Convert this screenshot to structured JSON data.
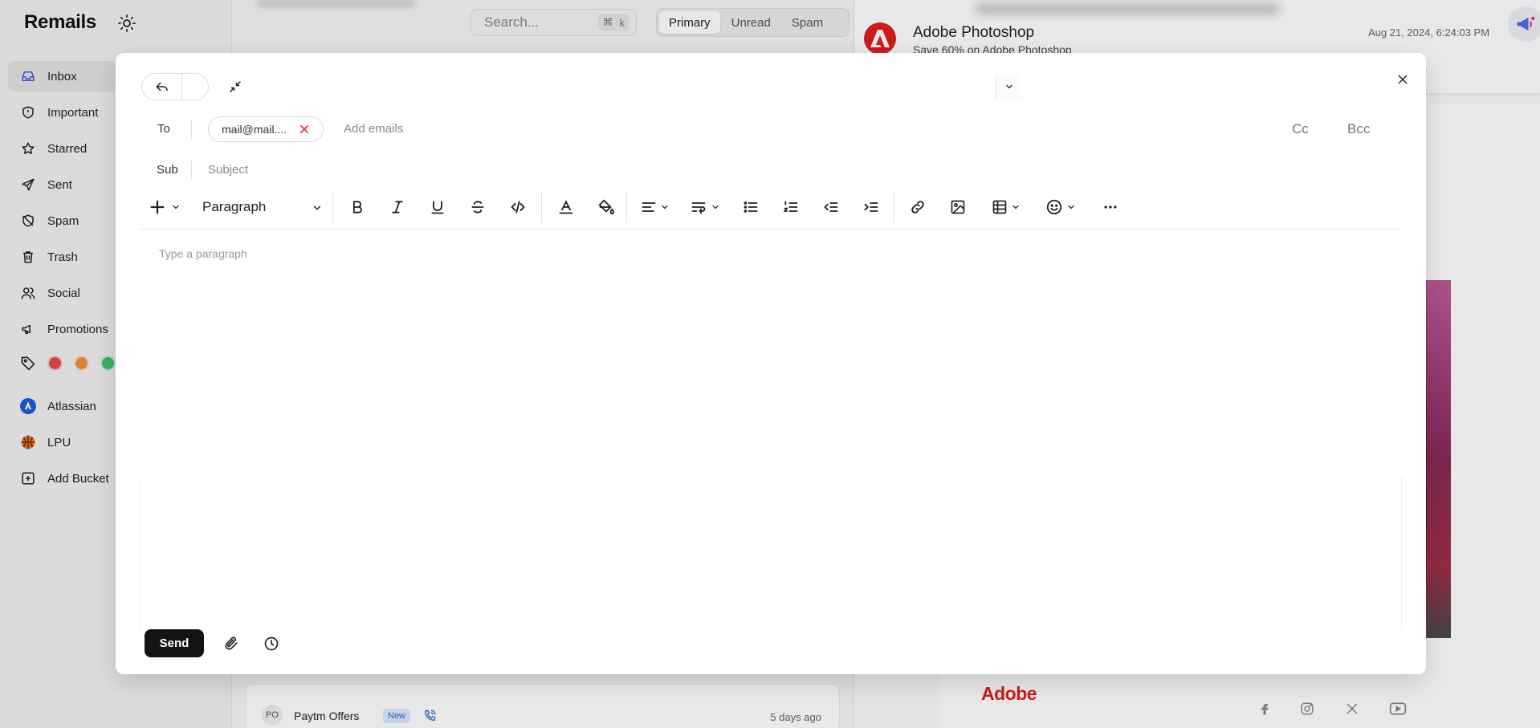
{
  "app": {
    "brand": "Remails"
  },
  "sidebar": {
    "items": [
      {
        "label": "Inbox",
        "icon": "inbox-icon"
      },
      {
        "label": "Important",
        "icon": "shield-icon"
      },
      {
        "label": "Starred",
        "icon": "star-icon"
      },
      {
        "label": "Sent",
        "icon": "send-icon"
      },
      {
        "label": "Spam",
        "icon": "shield-off-icon"
      },
      {
        "label": "Trash",
        "icon": "trash-icon"
      },
      {
        "label": "Social",
        "icon": "users-icon"
      },
      {
        "label": "Promotions",
        "icon": "megaphone-icon"
      }
    ],
    "tag_colors": [
      "#e5484d",
      "#f0933a",
      "#3cc46b"
    ],
    "buckets": [
      {
        "label": "Atlassian",
        "icon": "atlassian-logo-icon"
      },
      {
        "label": "LPU",
        "icon": "basketball-icon"
      }
    ],
    "add_bucket": "Add Bucket"
  },
  "mail_list": {
    "search_placeholder": "Search...",
    "shortcut": {
      "mod": "⌘",
      "key": "k"
    },
    "filters": [
      "Primary",
      "Unread",
      "Spam"
    ],
    "selected_filter": "Primary",
    "bottom_item": {
      "avatar": "PO",
      "sender": "Paytm Offers",
      "badge": "New",
      "time": "5 days ago"
    }
  },
  "reader": {
    "sender": "Adobe Photoshop",
    "subject_preview": "Save 60% on Adobe Photoshop",
    "date": "Aug 21, 2024, 6:24:03 PM",
    "footer_brand": "Adobe",
    "accent": "#e01e1e"
  },
  "compose": {
    "to_label": "To",
    "recipient": "mail@mail....",
    "add_emails_placeholder": "Add emails",
    "cc_label": "Cc",
    "bcc_label": "Bcc",
    "sub_label": "Sub",
    "subject_placeholder": "Subject",
    "block_type": "Paragraph",
    "body_placeholder": "Type a paragraph",
    "send_label": "Send"
  }
}
